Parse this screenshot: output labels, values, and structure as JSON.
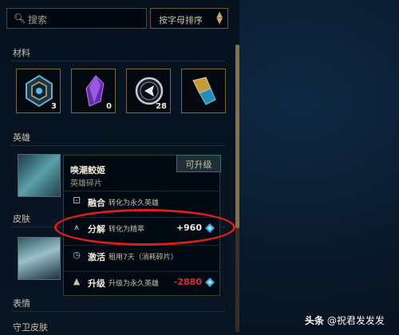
{
  "search": {
    "placeholder": "搜索"
  },
  "sort": {
    "label": "按字母排序"
  },
  "sections": {
    "materials": "材料",
    "champions": "英雄",
    "skins": "皮肤",
    "emotes": "表情",
    "ward_skins": "守卫皮肤"
  },
  "materials": [
    {
      "icon": "hextech-chest-icon",
      "count": "3"
    },
    {
      "icon": "purple-gem-icon",
      "count": "0"
    },
    {
      "icon": "hextech-key-icon",
      "count": "28"
    },
    {
      "icon": "key-fragment-icon",
      "count": ""
    }
  ],
  "popup": {
    "title": "唤潮鲛姬",
    "subtitle": "英雄碎片",
    "badge": "可升级",
    "rows": [
      {
        "icon": "dice-icon",
        "label": "融合",
        "desc": "转化为永久英雄",
        "value": ""
      },
      {
        "icon": "disenchant-icon",
        "label": "分解",
        "desc": "转化为精萃",
        "value": "+960"
      },
      {
        "icon": "clock-icon",
        "label": "激活",
        "desc": "租用7天（消耗碎片）",
        "value": ""
      },
      {
        "icon": "upgrade-icon",
        "label": "升级",
        "desc": "升级为永久英雄",
        "value": "-2880"
      }
    ]
  },
  "colors": {
    "accent_gold": "#c8aa6e",
    "essence_blue": "#3aa8d8",
    "negative_red": "#e0283a",
    "highlight_red": "#d8201a"
  },
  "watermark": {
    "prefix": "头条",
    "author": "@祝君发发发"
  }
}
